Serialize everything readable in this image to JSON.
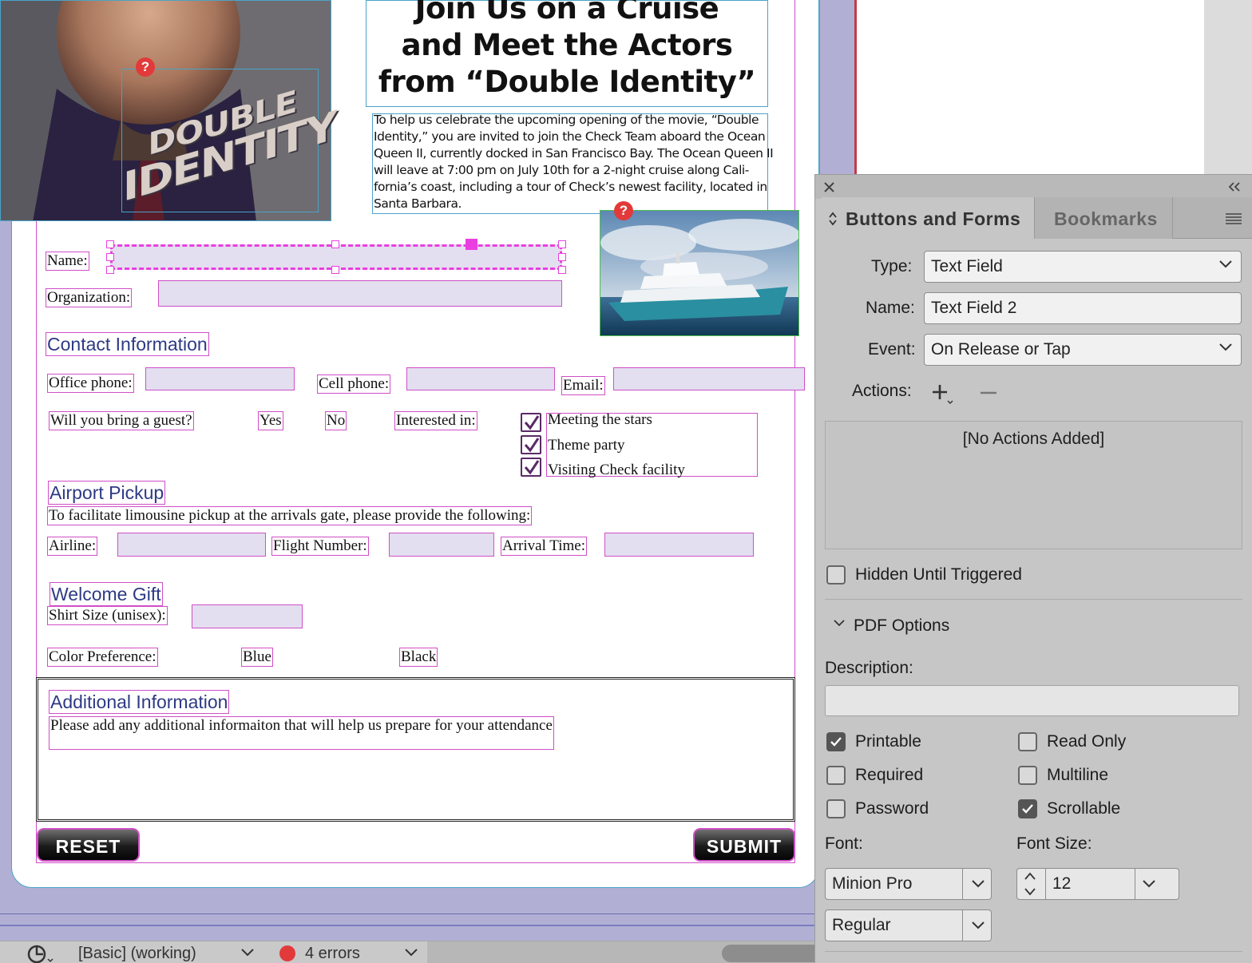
{
  "document": {
    "headline_lines": [
      "Join Us on a Cruise",
      "and Meet the Actors",
      "from “Double Identity”"
    ],
    "intro_lines": [
      "To help us celebrate the upcoming opening of the movie, “Double",
      "Identity,” you are invited to join the Check Team aboard the Ocean",
      "Queen II, currently docked in San Francisco Bay. The Ocean Queen II",
      "will leave at 7:00 pm on July 10th for a 2-night cruise along Cali-",
      "fornia’s coast, including a tour of Check’s newest facility, located in",
      "Santa Barbara."
    ],
    "poster_title_lines": [
      "DOUBLE",
      "IDENTITY"
    ],
    "error_marker": "?",
    "labels": {
      "name": "Name:",
      "organization": "Organization:",
      "office_phone": "Office phone:",
      "cell_phone": "Cell phone:",
      "email": "Email:",
      "guest_question": "Will you bring a guest?",
      "yes": "Yes",
      "no": "No",
      "interested_in": "Interested in:",
      "airline": "Airline:",
      "flight_number": "Flight Number:",
      "arrival_time": "Arrival Time:",
      "shirt_size": "Shirt Size (unisex):",
      "color_preference": "Color Preference:",
      "blue": "Blue",
      "black": "Black"
    },
    "headings": {
      "contact": "Contact Information",
      "airport": "Airport Pickup",
      "gift": "Welcome Gift",
      "additional": "Additional Information"
    },
    "interests": [
      "Meeting the stars",
      "Theme party",
      "Visiting Check facility"
    ],
    "airport_instructions": "To facilitate limousine pickup at the arrivals gate, please provide the following:",
    "additional_instructions": "Please add any additional informaiton that will help us prepare for your attendance",
    "buttons": {
      "reset": "RESET",
      "submit": "SUBMIT"
    }
  },
  "statusbar": {
    "preflight_profile": "[Basic] (working)",
    "errors": "4 errors"
  },
  "panel": {
    "tabs": {
      "active": "Buttons and Forms",
      "inactive": "Bookmarks"
    },
    "type_label": "Type:",
    "type_value": "Text Field",
    "name_label": "Name:",
    "name_value": "Text Field 2",
    "event_label": "Event:",
    "event_value": "On Release or Tap",
    "actions_label": "Actions:",
    "no_actions": "[No Actions Added]",
    "hidden_until_triggered": "Hidden Until Triggered",
    "pdf_options": "PDF Options",
    "description_label": "Description:",
    "description_value": "",
    "options": {
      "printable": "Printable",
      "read_only": "Read Only",
      "required": "Required",
      "multiline": "Multiline",
      "password": "Password",
      "scrollable": "Scrollable"
    },
    "option_states": {
      "printable": true,
      "read_only": false,
      "required": false,
      "multiline": false,
      "password": false,
      "scrollable": true,
      "hidden_until_triggered": false
    },
    "font_label": "Font:",
    "font_value": "Minion Pro",
    "font_style_value": "Regular",
    "font_size_label": "Font Size:",
    "font_size_value": "12"
  },
  "colors": {
    "frame_magenta": "#d04fc7",
    "heading_blue": "#2e3a84",
    "field_fill": "#e3dff0",
    "error_red": "#e23a3a",
    "pasteboard": "#b1b0d4",
    "panel_bg": "#c6c6c6"
  }
}
